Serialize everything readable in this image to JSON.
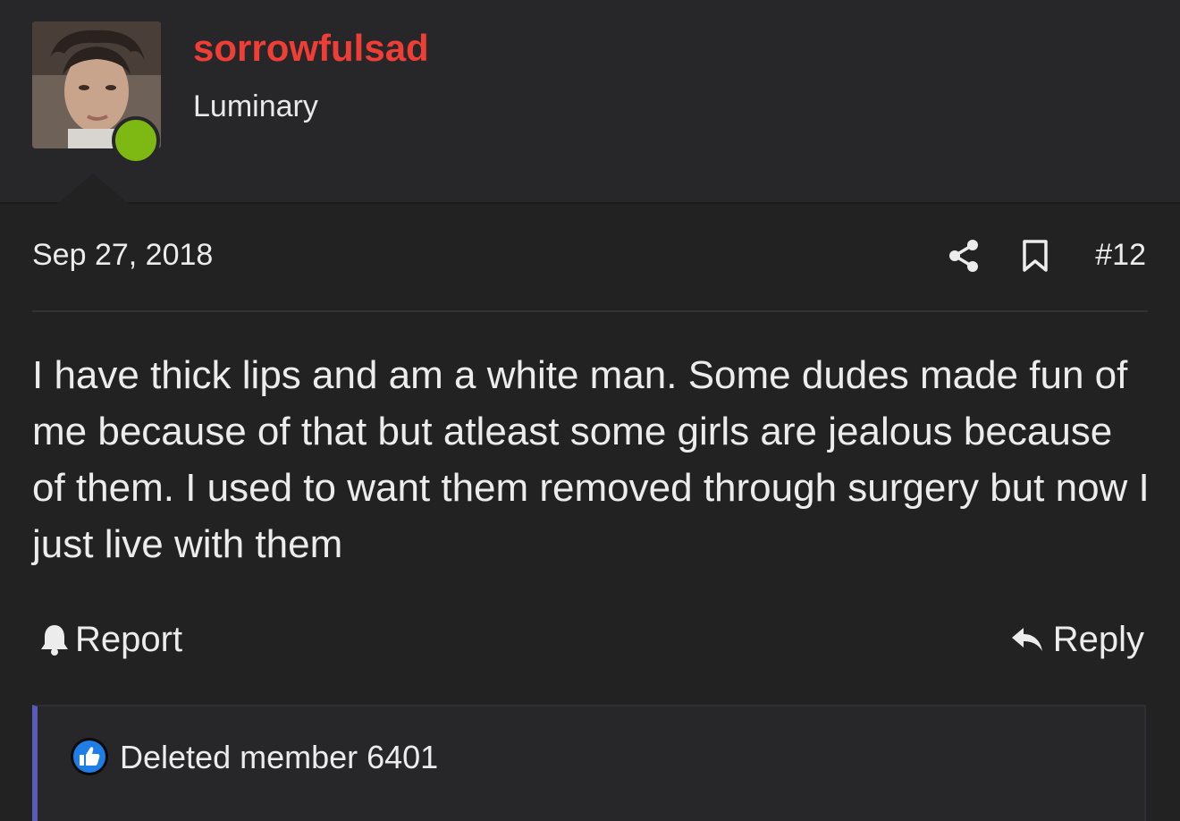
{
  "user": {
    "username": "sorrowfulsad",
    "title": "Luminary",
    "online_status_color": "#7eb812",
    "username_color": "#ef3e36"
  },
  "post": {
    "date": "Sep 27, 2018",
    "number": "#12",
    "body": "I have thick lips and am a white man. Some dudes made fun of me because of that but atleast some girls are jealous because of them. I used to want them removed through surgery but now I just live with them"
  },
  "actions": {
    "report_label": "Report",
    "reply_label": "Reply"
  },
  "reactions": {
    "users": "Deleted member 6401",
    "icon": "like-icon",
    "accent_color": "#5a5bb8"
  }
}
